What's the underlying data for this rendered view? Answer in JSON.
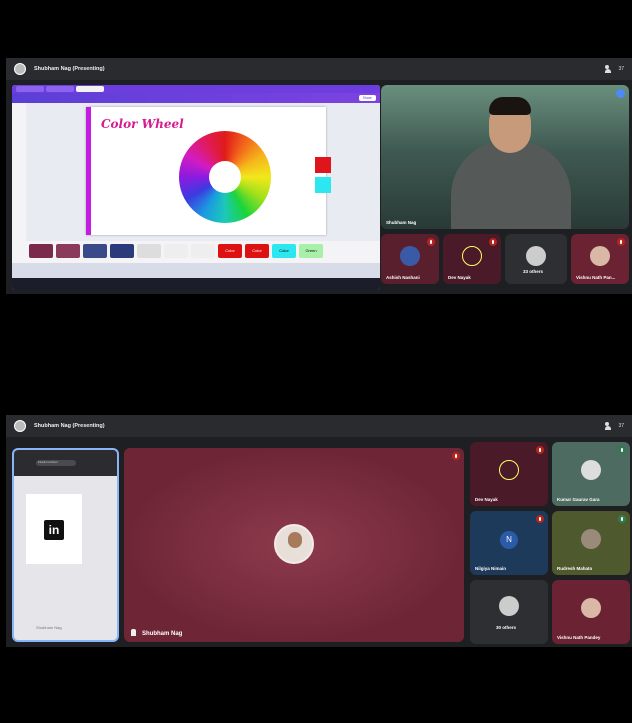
{
  "top": {
    "header_title": "Shubham Nag (Presenting)",
    "people_count": "37",
    "screen_share": {
      "slide_title": "Color Wheel",
      "share_label": "Share",
      "swatch_colors": [
        "#e0141b",
        "#2de7f0"
      ],
      "thumb_labels": [
        "Color",
        "Color",
        "Color",
        "Green"
      ]
    },
    "main_tile_name": "Shubham Nag",
    "participants": [
      {
        "name": "Ashish Nashani",
        "color": "#5a1f2c"
      },
      {
        "name": "Dev Nayak",
        "color": "#4a1a28"
      },
      {
        "name": "33 others",
        "color": "#2e2f33"
      },
      {
        "name": "Vishnu Nath Pan...",
        "color": "#6b2232"
      }
    ]
  },
  "bottom": {
    "header_title": "Shubham Nag (Presenting)",
    "people_count": "37",
    "phone_share": {
      "logo_text": "in",
      "url_text": "linkedin.com/feed",
      "caption": "Shubham Nag"
    },
    "main_speaker_name": "Shubham Nag",
    "grid": [
      {
        "name": "Dev Nayak",
        "color": "#4a1a28"
      },
      {
        "name": "Kumar Gaurav Gara",
        "color": "#4d6b60"
      },
      {
        "name": "Nilgiya Nimain",
        "color": "#1e3a5a",
        "initial": "N"
      },
      {
        "name": "Rudresh Mahato",
        "color": "#4e5a2e"
      },
      {
        "name": "30 others",
        "color": "#2e2f33"
      },
      {
        "name": "Vishnu Nath Pandey",
        "color": "#6b2232"
      }
    ]
  }
}
